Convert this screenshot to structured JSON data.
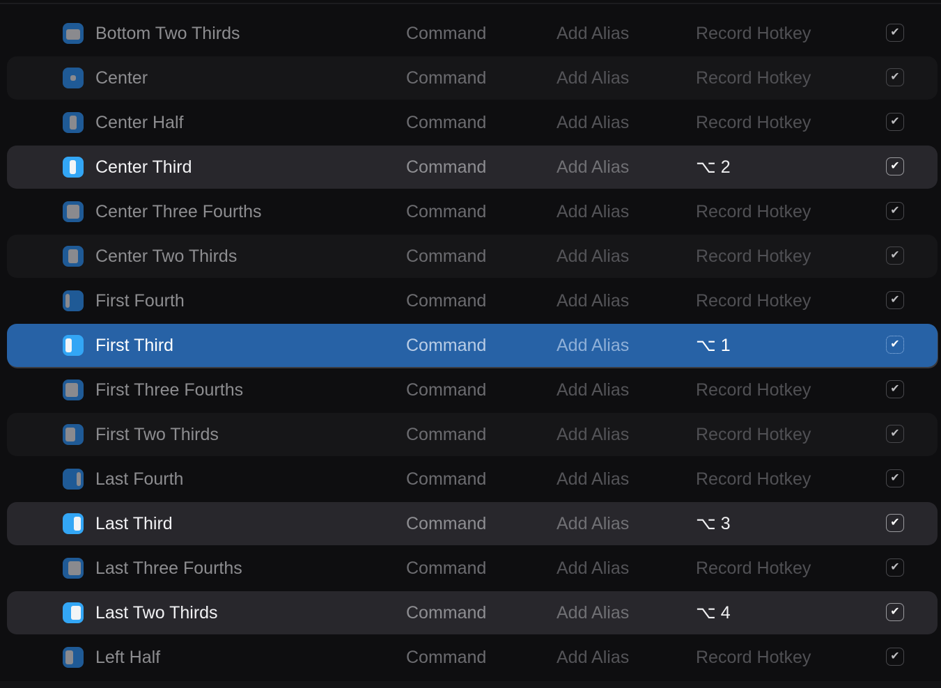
{
  "colors": {
    "background": "#0e0e10",
    "selected": "#2762a6",
    "active_row": "#28272c",
    "icon_blue": "#33a6f5"
  },
  "columns": {
    "command": "Command",
    "alias": "Add Alias",
    "record": "Record Hotkey"
  },
  "rows": [
    {
      "name": "Bottom Two Thirds",
      "icon": "bottom-two-thirds",
      "hotkey": "Record Hotkey",
      "state": "normal",
      "enabled": true
    },
    {
      "name": "Center",
      "icon": "center",
      "hotkey": "Record Hotkey",
      "state": "alt",
      "enabled": true
    },
    {
      "name": "Center Half",
      "icon": "center-half",
      "hotkey": "Record Hotkey",
      "state": "normal",
      "enabled": true
    },
    {
      "name": "Center Third",
      "icon": "center-third",
      "hotkey": "⌥ 2",
      "state": "active",
      "enabled": true
    },
    {
      "name": "Center Three Fourths",
      "icon": "center-three-fourths",
      "hotkey": "Record Hotkey",
      "state": "normal",
      "enabled": true
    },
    {
      "name": "Center Two Thirds",
      "icon": "center-two-thirds",
      "hotkey": "Record Hotkey",
      "state": "alt",
      "enabled": true
    },
    {
      "name": "First Fourth",
      "icon": "first-fourth",
      "hotkey": "Record Hotkey",
      "state": "normal",
      "enabled": true
    },
    {
      "name": "First Third",
      "icon": "first-third",
      "hotkey": "⌥ 1",
      "state": "selected",
      "enabled": true
    },
    {
      "name": "First Three Fourths",
      "icon": "first-three-fourths",
      "hotkey": "Record Hotkey",
      "state": "normal",
      "enabled": true
    },
    {
      "name": "First Two Thirds",
      "icon": "first-two-thirds",
      "hotkey": "Record Hotkey",
      "state": "alt",
      "enabled": true
    },
    {
      "name": "Last Fourth",
      "icon": "last-fourth",
      "hotkey": "Record Hotkey",
      "state": "normal",
      "enabled": true
    },
    {
      "name": "Last Third",
      "icon": "last-third",
      "hotkey": "⌥ 3",
      "state": "active",
      "enabled": true
    },
    {
      "name": "Last Three Fourths",
      "icon": "last-three-fourths",
      "hotkey": "Record Hotkey",
      "state": "normal",
      "enabled": true
    },
    {
      "name": "Last Two Thirds",
      "icon": "last-two-thirds",
      "hotkey": "⌥ 4",
      "state": "active",
      "enabled": true
    },
    {
      "name": "Left Half",
      "icon": "left-half",
      "hotkey": "Record Hotkey",
      "state": "normal",
      "enabled": true
    }
  ]
}
